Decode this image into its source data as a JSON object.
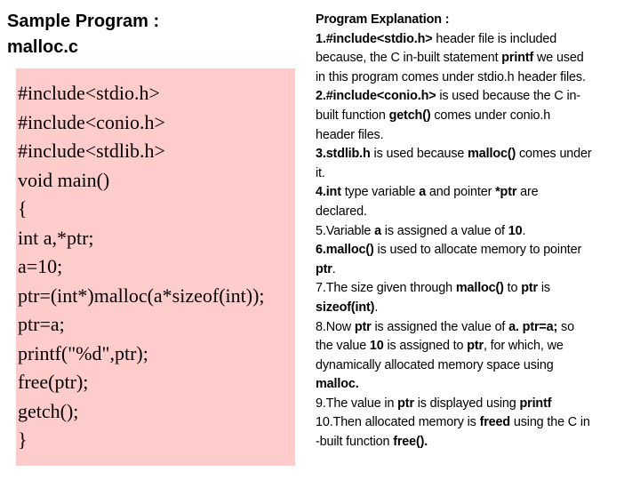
{
  "title": {
    "line1": "Sample Program :",
    "line2": "malloc.c"
  },
  "code": {
    "background": "#ffcccc",
    "lines": [
      "#include<stdio.h>",
      "#include<conio.h>",
      "#include<stdlib.h>",
      "void main()",
      "{",
      "int a,*ptr;",
      "a=10;",
      "ptr=(int*)malloc(a*sizeof(int));",
      "ptr=a;",
      "printf(\"%d\",ptr);",
      "free(ptr);",
      "getch();",
      "}"
    ]
  },
  "explanation": {
    "heading": "Program Explanation :",
    "lines": [
      [
        {
          "t": "1.#include<stdio.h>",
          "b": true
        },
        {
          "t": " header file is included",
          "b": false
        }
      ],
      [
        {
          "t": "because, the C in-built statement ",
          "b": false
        },
        {
          "t": "printf",
          "b": true
        },
        {
          "t": " we used",
          "b": false
        }
      ],
      [
        {
          "t": "in this program comes under stdio.h header files.",
          "b": false
        }
      ],
      [
        {
          "t": "2.#include<conio.h>",
          "b": true
        },
        {
          "t": " is used because the C in-",
          "b": false
        }
      ],
      [
        {
          "t": "built function ",
          "b": false
        },
        {
          "t": "getch()",
          "b": true
        },
        {
          "t": " comes under conio.h",
          "b": false
        }
      ],
      [
        {
          "t": "header files.",
          "b": false
        }
      ],
      [
        {
          "t": "3.stdlib.h",
          "b": true
        },
        {
          "t": " is used because ",
          "b": false
        },
        {
          "t": "malloc()",
          "b": true
        },
        {
          "t": " comes under",
          "b": false
        }
      ],
      [
        {
          "t": "it.",
          "b": false
        }
      ],
      [
        {
          "t": "4.int",
          "b": true
        },
        {
          "t": " type variable ",
          "b": false
        },
        {
          "t": "a",
          "b": true
        },
        {
          "t": " and pointer ",
          "b": false
        },
        {
          "t": "*ptr",
          "b": true
        },
        {
          "t": " are",
          "b": false
        }
      ],
      [
        {
          "t": "declared.",
          "b": false
        }
      ],
      [
        {
          "t": "5.Variable ",
          "b": false
        },
        {
          "t": "a",
          "b": true
        },
        {
          "t": " is assigned a value of ",
          "b": false
        },
        {
          "t": "10",
          "b": true
        },
        {
          "t": ".",
          "b": false
        }
      ],
      [
        {
          "t": "6.malloc()",
          "b": true
        },
        {
          "t": " is used to allocate memory to pointer",
          "b": false
        }
      ],
      [
        {
          "t": "ptr",
          "b": true
        },
        {
          "t": ".",
          "b": false
        }
      ],
      [
        {
          "t": "7.The size given through ",
          "b": false
        },
        {
          "t": "malloc()",
          "b": true
        },
        {
          "t": " to ",
          "b": false
        },
        {
          "t": "ptr",
          "b": true
        },
        {
          "t": " is",
          "b": false
        }
      ],
      [
        {
          "t": "sizeof(int)",
          "b": true
        },
        {
          "t": ".",
          "b": false
        }
      ],
      [
        {
          "t": "8.Now ",
          "b": false
        },
        {
          "t": "ptr",
          "b": true
        },
        {
          "t": " is assigned the value of ",
          "b": false
        },
        {
          "t": "a. ptr=a;",
          "b": true
        },
        {
          "t": " so",
          "b": false
        }
      ],
      [
        {
          "t": "the value ",
          "b": false
        },
        {
          "t": "10",
          "b": true
        },
        {
          "t": " is assigned to ",
          "b": false
        },
        {
          "t": "ptr",
          "b": true
        },
        {
          "t": ", for which, we",
          "b": false
        }
      ],
      [
        {
          "t": "dynamically allocated memory space using",
          "b": false
        }
      ],
      [
        {
          "t": "malloc.",
          "b": true
        }
      ],
      [
        {
          "t": "9.The value in ",
          "b": false
        },
        {
          "t": "ptr",
          "b": true
        },
        {
          "t": " is displayed using ",
          "b": false
        },
        {
          "t": "printf",
          "b": true
        }
      ],
      [
        {
          "t": "10.Then allocated memory is ",
          "b": false
        },
        {
          "t": "freed",
          "b": true
        },
        {
          "t": " using the C in",
          "b": false
        }
      ],
      [
        {
          "t": "-built function ",
          "b": false
        },
        {
          "t": "free().",
          "b": true
        }
      ]
    ]
  }
}
